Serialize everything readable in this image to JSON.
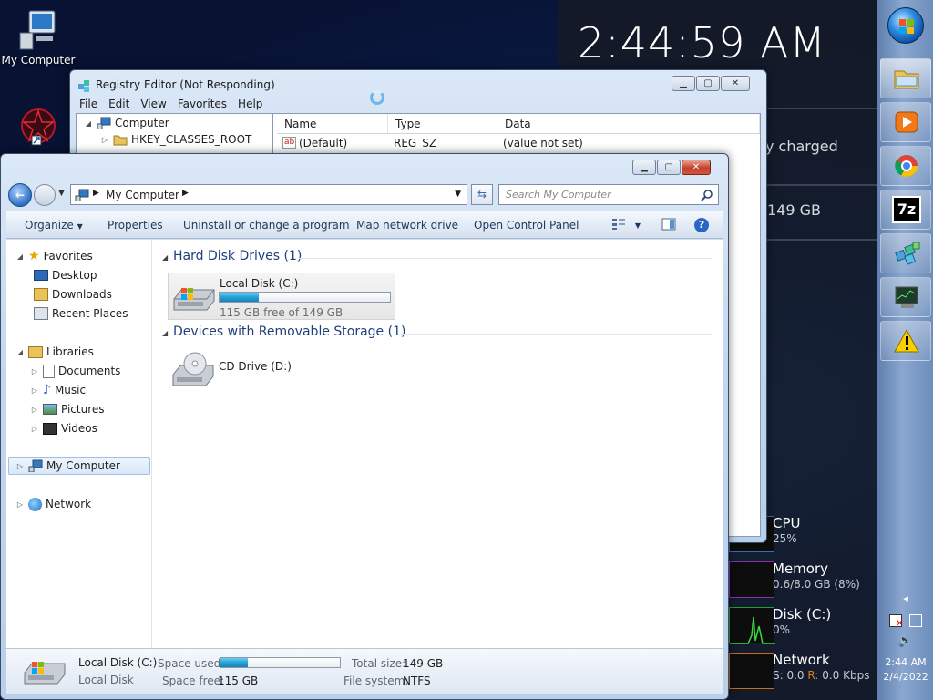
{
  "desktop": {
    "my_computer_label": "My Computer"
  },
  "gadgets": {
    "clock": "2:44:59 AM",
    "battery_text": "y charged",
    "disk_text": "149 GB",
    "meters": [
      {
        "label": "CPU",
        "value": "25%"
      },
      {
        "label": "Memory",
        "value": "0.6/8.0 GB (8%)"
      },
      {
        "label": "Disk (C:)",
        "value": "0%"
      },
      {
        "label": "Network",
        "value_prefix_s": "S: 0.0",
        "value_r_label": "R:",
        "value_r": "0.0 Kbps"
      }
    ]
  },
  "taskbar": {
    "time": "2:44 AM",
    "date": "2/4/2022",
    "sevenzip_label": "7z"
  },
  "registry": {
    "title": "Registry Editor (Not Responding)",
    "menu": [
      "File",
      "Edit",
      "View",
      "Favorites",
      "Help"
    ],
    "tree_root": "Computer",
    "tree_items": [
      "HKEY_CLASSES_ROOT"
    ],
    "columns": [
      "Name",
      "Type",
      "Data"
    ],
    "rows": [
      {
        "icon": "ab",
        "name": "(Default)",
        "type": "REG_SZ",
        "data": "(value not set)"
      }
    ]
  },
  "explorer": {
    "address": "My Computer",
    "search_placeholder": "Search My Computer",
    "commands": [
      "Organize",
      "Properties",
      "Uninstall or change a program",
      "Map network drive",
      "Open Control Panel"
    ],
    "nav": {
      "favorites": "Favorites",
      "favorites_items": [
        "Desktop",
        "Downloads",
        "Recent Places"
      ],
      "libraries": "Libraries",
      "libraries_items": [
        "Documents",
        "Music",
        "Pictures",
        "Videos"
      ],
      "my_computer": "My Computer",
      "network": "Network"
    },
    "groups": {
      "hdd_title": "Hard Disk Drives (1)",
      "removable_title": "Devices with Removable Storage (1)"
    },
    "local_disk": {
      "name": "Local Disk (C:)",
      "free_text": "115 GB free of 149 GB",
      "used_fraction": 0.23
    },
    "cd_drive": {
      "name": "CD Drive (D:)"
    },
    "details": {
      "name": "Local Disk (C:)",
      "type": "Local Disk",
      "space_used_label": "Space used:",
      "space_free_label": "Space free:",
      "space_free": "115 GB",
      "total_size_label": "Total size:",
      "total_size": "149 GB",
      "file_system_label": "File system:",
      "file_system": "NTFS",
      "used_fraction": 0.23
    }
  },
  "colors": {
    "accent": "#1e3f7a",
    "progress": "#26a0da",
    "network_r": "#e07b1a"
  }
}
